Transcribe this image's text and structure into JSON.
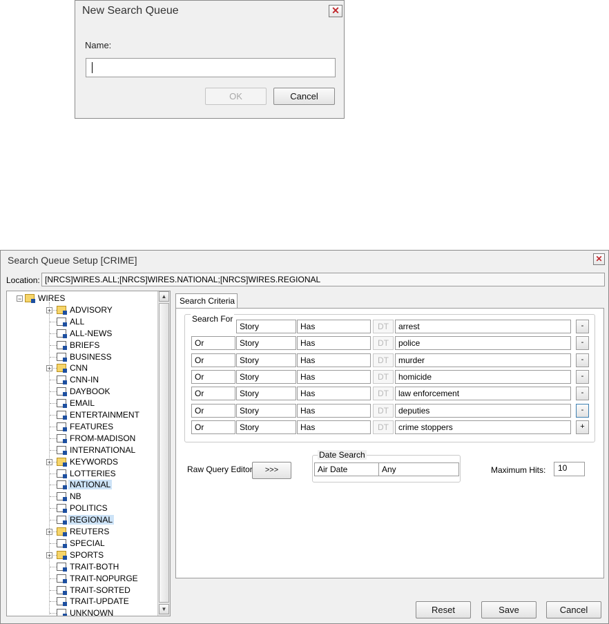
{
  "new_search_queue_dialog": {
    "title": "New Search Queue",
    "name_label": "Name:",
    "name_value": "",
    "ok_label": "OK",
    "cancel_label": "Cancel",
    "close_icon": "close-icon"
  },
  "setup_dialog": {
    "title": "Search Queue Setup [CRIME]",
    "location_label": "Location:",
    "location_value": "[NRCS]WIRES.ALL;[NRCS]WIRES.NATIONAL;[NRCS]WIRES.REGIONAL",
    "tree": {
      "root": "WIRES",
      "items": [
        {
          "label": "ADVISORY",
          "type": "folder",
          "expandable": true,
          "selected": false
        },
        {
          "label": "ALL",
          "type": "queue",
          "expandable": false,
          "selected": false
        },
        {
          "label": "ALL-NEWS",
          "type": "queue",
          "expandable": false,
          "selected": false
        },
        {
          "label": "BRIEFS",
          "type": "queue",
          "expandable": false,
          "selected": false
        },
        {
          "label": "BUSINESS",
          "type": "queue",
          "expandable": false,
          "selected": false
        },
        {
          "label": "CNN",
          "type": "folder",
          "expandable": true,
          "selected": false
        },
        {
          "label": "CNN-IN",
          "type": "queue",
          "expandable": false,
          "selected": false
        },
        {
          "label": "DAYBOOK",
          "type": "queue",
          "expandable": false,
          "selected": false
        },
        {
          "label": "EMAIL",
          "type": "queue",
          "expandable": false,
          "selected": false
        },
        {
          "label": "ENTERTAINMENT",
          "type": "queue",
          "expandable": false,
          "selected": false
        },
        {
          "label": "FEATURES",
          "type": "queue",
          "expandable": false,
          "selected": false
        },
        {
          "label": "FROM-MADISON",
          "type": "queue",
          "expandable": false,
          "selected": false
        },
        {
          "label": "INTERNATIONAL",
          "type": "queue",
          "expandable": false,
          "selected": false
        },
        {
          "label": "KEYWORDS",
          "type": "folder",
          "expandable": true,
          "selected": false
        },
        {
          "label": "LOTTERIES",
          "type": "queue",
          "expandable": false,
          "selected": false
        },
        {
          "label": "NATIONAL",
          "type": "queue",
          "expandable": false,
          "selected": true
        },
        {
          "label": "NB",
          "type": "queue",
          "expandable": false,
          "selected": false
        },
        {
          "label": "POLITICS",
          "type": "queue",
          "expandable": false,
          "selected": false
        },
        {
          "label": "REGIONAL",
          "type": "queue",
          "expandable": false,
          "selected": true
        },
        {
          "label": "REUTERS",
          "type": "folder",
          "expandable": true,
          "selected": false
        },
        {
          "label": "SPECIAL",
          "type": "queue",
          "expandable": false,
          "selected": false
        },
        {
          "label": "SPORTS",
          "type": "folder",
          "expandable": true,
          "selected": false
        },
        {
          "label": "TRAIT-BOTH",
          "type": "queue",
          "expandable": false,
          "selected": false
        },
        {
          "label": "TRAIT-NOPURGE",
          "type": "queue",
          "expandable": false,
          "selected": false
        },
        {
          "label": "TRAIT-SORTED",
          "type": "queue",
          "expandable": false,
          "selected": false
        },
        {
          "label": "TRAIT-UPDATE",
          "type": "queue",
          "expandable": false,
          "selected": false
        },
        {
          "label": "UNKNOWN",
          "type": "queue",
          "expandable": false,
          "selected": false
        }
      ]
    },
    "tab_label": "Search Criteria",
    "search_for_label": "Search For",
    "criteria": [
      {
        "op": "",
        "field": "Story",
        "cond": "Has",
        "dt": "DT",
        "value": "arrest",
        "btn": "-"
      },
      {
        "op": "Or",
        "field": "Story",
        "cond": "Has",
        "dt": "DT",
        "value": "police",
        "btn": "-"
      },
      {
        "op": "Or",
        "field": "Story",
        "cond": "Has",
        "dt": "DT",
        "value": "murder",
        "btn": "-"
      },
      {
        "op": "Or",
        "field": "Story",
        "cond": "Has",
        "dt": "DT",
        "value": "homicide",
        "btn": "-"
      },
      {
        "op": "Or",
        "field": "Story",
        "cond": "Has",
        "dt": "DT",
        "value": "law enforcement",
        "btn": "-"
      },
      {
        "op": "Or",
        "field": "Story",
        "cond": "Has",
        "dt": "DT",
        "value": "deputies",
        "btn": "-"
      },
      {
        "op": "Or",
        "field": "Story",
        "cond": "Has",
        "dt": "DT",
        "value": "crime stoppers",
        "btn": "+"
      }
    ],
    "raw_query_label": "Raw Query Editor",
    "raw_query_button": ">>>",
    "date_search": {
      "label": "Date Search",
      "field": "Air Date",
      "value": "Any"
    },
    "max_hits_label": "Maximum Hits:",
    "max_hits_value": "10",
    "reset_label": "Reset",
    "save_label": "Save",
    "cancel_label": "Cancel"
  }
}
